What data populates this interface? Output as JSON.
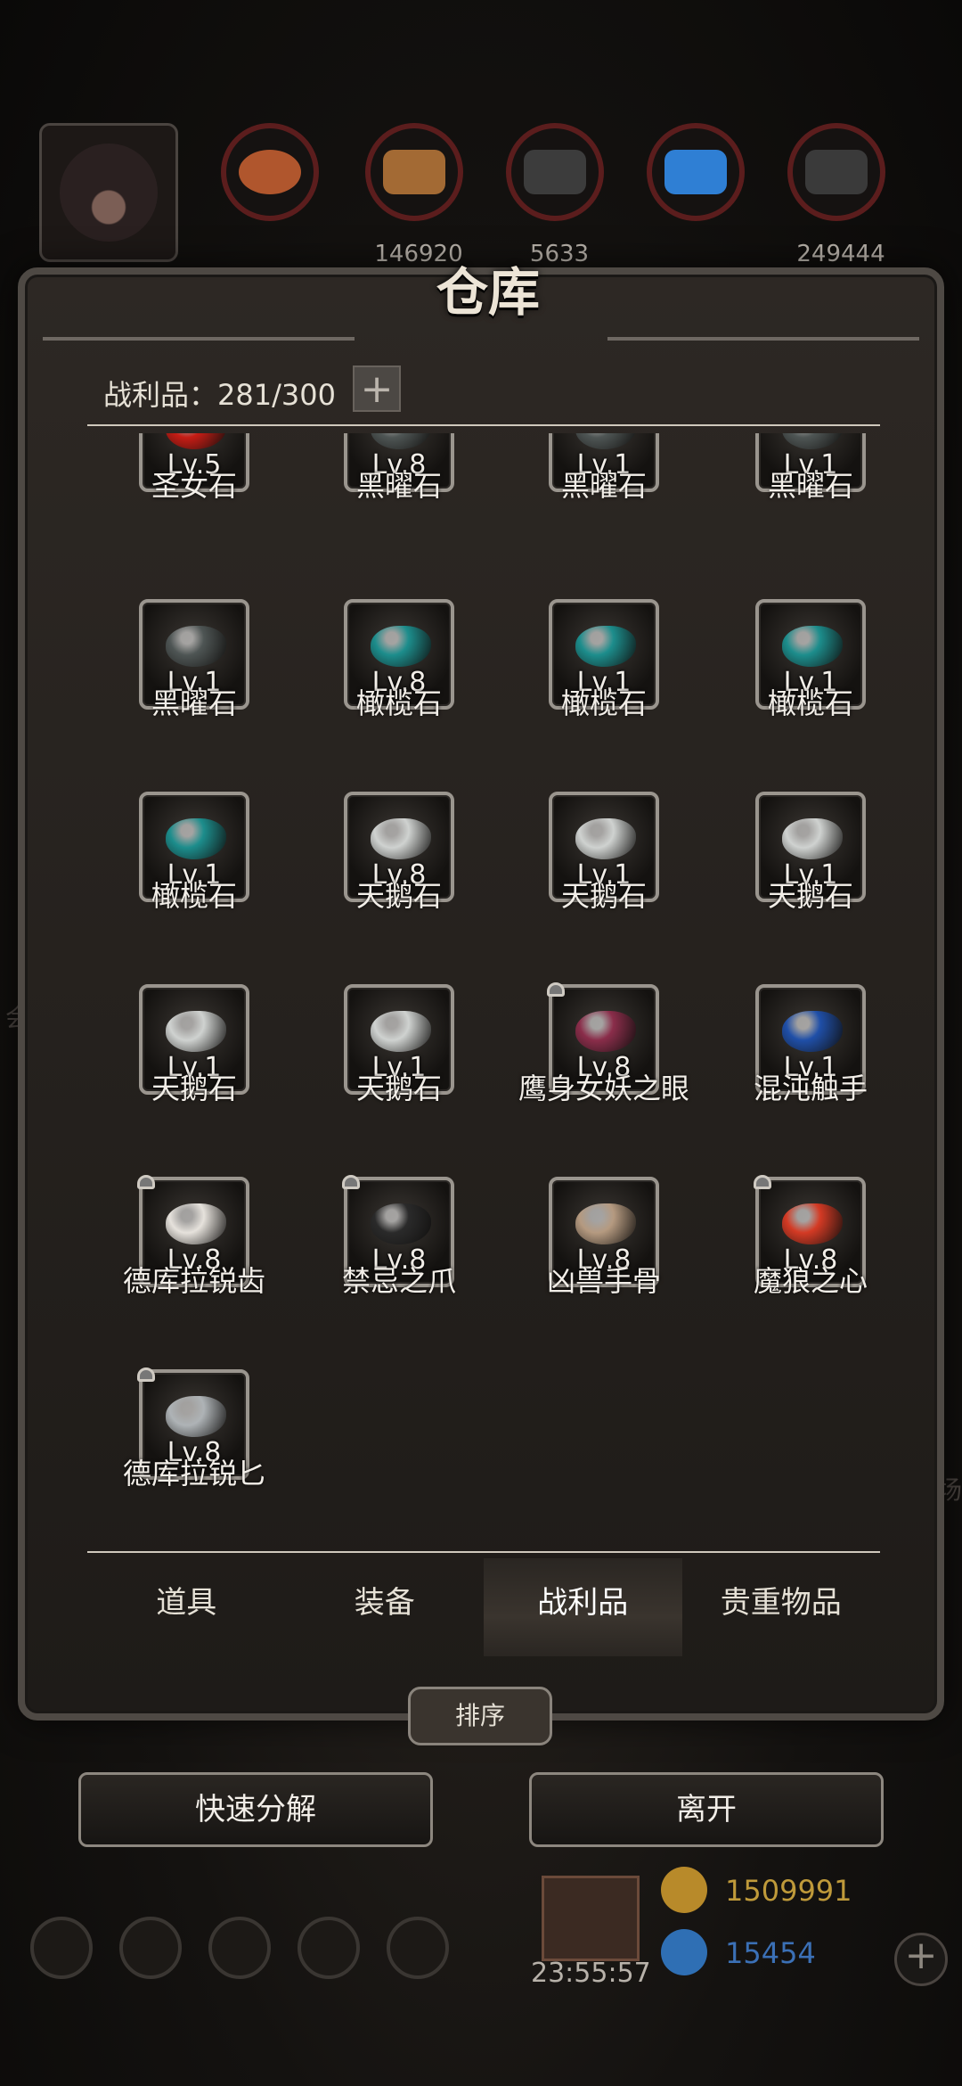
{
  "resources": [
    {
      "icon": "copper-ore-icon",
      "count": "",
      "color": "#b0562d"
    },
    {
      "icon": "wood-plank-icon",
      "count": "146920",
      "color": "#a36a34"
    },
    {
      "icon": "iron-ingot-icon",
      "count": "5633",
      "color": "#3c3c3c"
    },
    {
      "icon": "crystal-icon",
      "count": "",
      "color": "#2f7fd4"
    },
    {
      "icon": "stone-icon",
      "count": "249444",
      "color": "#3a3a3a"
    }
  ],
  "dialog": {
    "title": "仓库",
    "capacity": "战利品：281/300",
    "add_symbol": "+"
  },
  "items": [
    {
      "name": "圣女石",
      "level": "Lv.5",
      "color": "#c51c14",
      "locked": false
    },
    {
      "name": "黑曜石",
      "level": "Lv.8",
      "color": "#4e5554",
      "locked": false
    },
    {
      "name": "黑曜石",
      "level": "Lv.1",
      "color": "#4e5554",
      "locked": false
    },
    {
      "name": "黑曜石",
      "level": "Lv.1",
      "color": "#4e5554",
      "locked": false
    },
    {
      "name": "黑曜石",
      "level": "Lv.1",
      "color": "#4e5554",
      "locked": false
    },
    {
      "name": "橄榄石",
      "level": "Lv.8",
      "color": "#1c8d8c",
      "locked": false
    },
    {
      "name": "橄榄石",
      "level": "Lv.1",
      "color": "#1c8d8c",
      "locked": false
    },
    {
      "name": "橄榄石",
      "level": "Lv.1",
      "color": "#1c8d8c",
      "locked": false
    },
    {
      "name": "橄榄石",
      "level": "Lv.1",
      "color": "#1c8d8c",
      "locked": false
    },
    {
      "name": "天鹅石",
      "level": "Lv.8",
      "color": "#cfd2d0",
      "locked": false
    },
    {
      "name": "天鹅石",
      "level": "Lv.1",
      "color": "#cfd2d0",
      "locked": false
    },
    {
      "name": "天鹅石",
      "level": "Lv.1",
      "color": "#cfd2d0",
      "locked": false
    },
    {
      "name": "天鹅石",
      "level": "Lv.1",
      "color": "#cfd2d0",
      "locked": false
    },
    {
      "name": "天鹅石",
      "level": "Lv.1",
      "color": "#cfd2d0",
      "locked": false
    },
    {
      "name": "鹰身女妖之眼",
      "level": "Lv.8",
      "color": "#8a2d4a",
      "locked": true
    },
    {
      "name": "混沌触手",
      "level": "Lv.1",
      "color": "#1f4fa8",
      "locked": false
    },
    {
      "name": "德库拉锐齿",
      "level": "Lv.8",
      "color": "#e6e2dc",
      "locked": true
    },
    {
      "name": "禁忌之爪",
      "level": "Lv.8",
      "color": "#2a2a2a",
      "locked": true
    },
    {
      "name": "凶兽手骨",
      "level": "Lv.8",
      "color": "#b59a80",
      "locked": false
    },
    {
      "name": "魔狼之心",
      "level": "Lv.8",
      "color": "#d43a24",
      "locked": true
    },
    {
      "name": "德库拉锐匕",
      "level": "Lv.8",
      "color": "#aeb3b6",
      "locked": true
    }
  ],
  "tabs": [
    "道具",
    "装备",
    "战利品",
    "贵重物品"
  ],
  "sort_label": "排序",
  "quick_decompose_label": "快速分解",
  "leave_label": "离开",
  "timer": "23:55:57",
  "gold": "1509991",
  "gems": "15454",
  "plus_symbol": "+",
  "side_text_left": "会",
  "side_text_right": "场"
}
